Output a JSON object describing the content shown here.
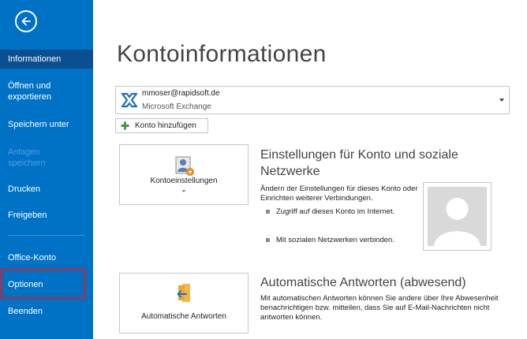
{
  "sidebar": {
    "back_icon": "back-arrow-icon",
    "items": [
      {
        "label": "Informationen",
        "active": true,
        "disabled": false
      },
      {
        "label": "Öffnen und exportieren",
        "active": false,
        "disabled": false
      },
      {
        "label": "Speichern unter",
        "active": false,
        "disabled": false
      },
      {
        "label": "Anlagen speichern",
        "active": false,
        "disabled": true
      },
      {
        "label": "Drucken",
        "active": false,
        "disabled": false
      },
      {
        "label": "Freigeben",
        "active": false,
        "disabled": false
      },
      {
        "label": "Office-Konto",
        "active": false,
        "disabled": false
      },
      {
        "label": "Optionen",
        "active": false,
        "disabled": false
      },
      {
        "label": "Beenden",
        "active": false,
        "disabled": false
      }
    ]
  },
  "main": {
    "title": "Kontoinformationen",
    "account": {
      "email": "mmoser@rapidsoft.de",
      "type": "Microsoft Exchange",
      "icon": "exchange-icon"
    },
    "add_account_label": "Konto hinzufügen",
    "account_settings": {
      "tile_label": "Kontoeinstellungen",
      "heading": "Einstellungen für Konto und soziale Netzwerke",
      "description": "Ändern der Einstellungen für dieses Konto oder Einrichten weiterer Verbindungen.",
      "bullets": [
        "Zugriff auf dieses Konto im Internet.",
        "Mit sozialen Netzwerken verbinden."
      ]
    },
    "auto_reply": {
      "tile_label": "Automatische Antworten",
      "heading": "Automatische Antworten (abwesend)",
      "description": "Mit automatischen Antworten können Sie andere über Ihre Abwesenheit benachrichtigen bzw. mitteilen, dass Sie auf E-Mail-Nachrichten nicht antworten können."
    }
  },
  "colors": {
    "sidebar": "#0072c6",
    "sidebar_active": "#0a4f8f",
    "highlight_border": "#d0202a"
  }
}
